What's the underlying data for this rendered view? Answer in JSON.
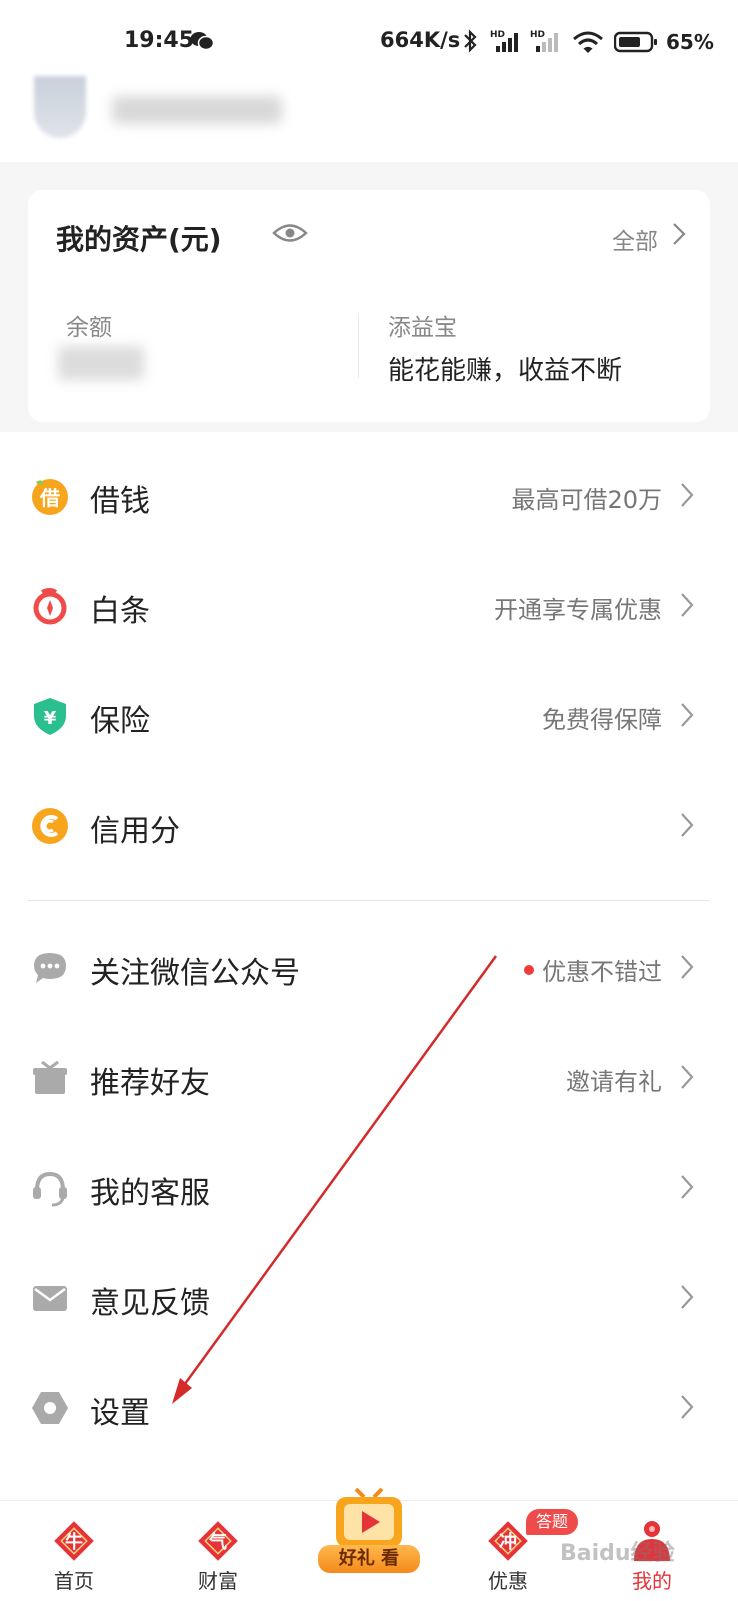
{
  "status_bar": {
    "time": "19:45",
    "speed": "664K/s",
    "battery": "65%"
  },
  "asset_card": {
    "title": "我的资产(元)",
    "all_link": "全部",
    "balance_label": "余额",
    "tianyibao_label": "添益宝",
    "tianyibao_desc": "能花能赚，收益不断"
  },
  "menu": {
    "borrow": {
      "label": "借钱",
      "right": "最高可借20万",
      "icon_glyph": "借"
    },
    "baitiao": {
      "label": "白条",
      "right": "开通享专属优惠"
    },
    "insurance": {
      "label": "保险",
      "right": "免费得保障",
      "icon_glyph": "¥"
    },
    "credit": {
      "label": "信用分",
      "right": ""
    },
    "wechat": {
      "label": "关注微信公众号",
      "right": "优惠不错过"
    },
    "refer": {
      "label": "推荐好友",
      "right": "邀请有礼"
    },
    "service": {
      "label": "我的客服",
      "right": ""
    },
    "feedback": {
      "label": "意见反馈",
      "right": ""
    },
    "settings": {
      "label": "设置",
      "right": ""
    }
  },
  "tabbar": {
    "home": {
      "label": "首页",
      "glyph": "牛"
    },
    "wealth": {
      "label": "财富",
      "glyph": "气"
    },
    "center": {
      "label": "好礼 看"
    },
    "deals": {
      "label": "优惠",
      "glyph": "冲",
      "badge": "答题"
    },
    "mine": {
      "label": "我的"
    },
    "watermark": "Baidu经验"
  },
  "colors": {
    "accent": "#e5333a",
    "annotation": "#d42a2a",
    "secondary_text": "#777777"
  }
}
